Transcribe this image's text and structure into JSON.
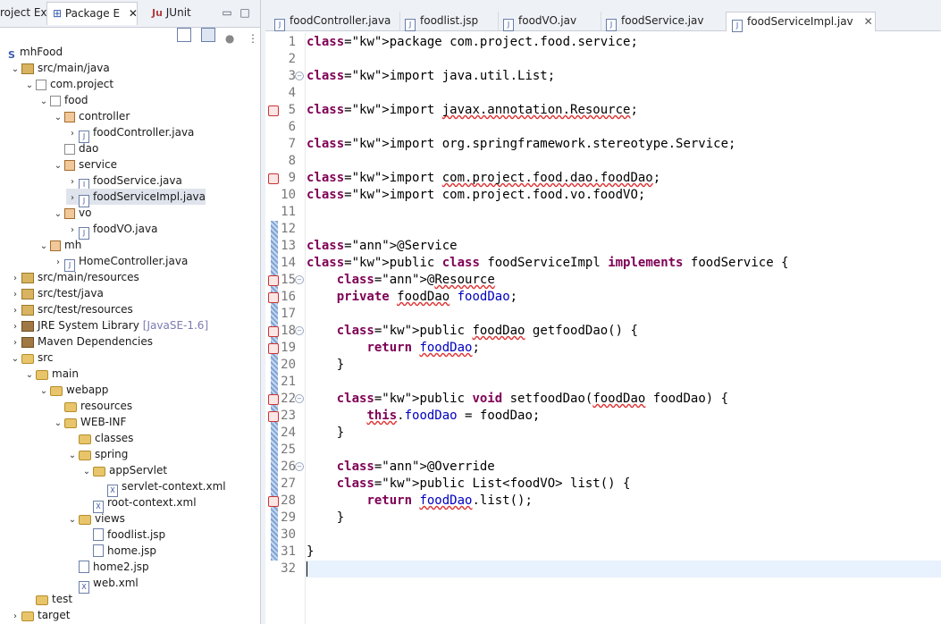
{
  "left_panel": {
    "tabs": [
      {
        "label": "roject Ex"
      },
      {
        "label": "Package E"
      },
      {
        "label": "JUnit"
      }
    ],
    "tree": [
      {
        "indent": 0,
        "twisty": "",
        "icon": "project",
        "label": "mhFood"
      },
      {
        "indent": 1,
        "twisty": "v",
        "icon": "srcfolder",
        "label": "src/main/java"
      },
      {
        "indent": 2,
        "twisty": "v",
        "icon": "package-empty",
        "label": "com.project"
      },
      {
        "indent": 3,
        "twisty": "v",
        "icon": "package-empty",
        "label": "food"
      },
      {
        "indent": 4,
        "twisty": "v",
        "icon": "package",
        "label": "controller"
      },
      {
        "indent": 5,
        "twisty": ">",
        "icon": "java",
        "label": "foodController.java"
      },
      {
        "indent": 4,
        "twisty": "",
        "icon": "package-empty",
        "label": "dao"
      },
      {
        "indent": 4,
        "twisty": "v",
        "icon": "package",
        "label": "service"
      },
      {
        "indent": 5,
        "twisty": ">",
        "icon": "java-interface",
        "label": "foodService.java"
      },
      {
        "indent": 5,
        "twisty": ">",
        "icon": "java",
        "label": "foodServiceImpl.java",
        "selected": true
      },
      {
        "indent": 4,
        "twisty": "v",
        "icon": "package",
        "label": "vo"
      },
      {
        "indent": 5,
        "twisty": ">",
        "icon": "java",
        "label": "foodVO.java"
      },
      {
        "indent": 3,
        "twisty": "v",
        "icon": "package",
        "label": "mh"
      },
      {
        "indent": 4,
        "twisty": ">",
        "icon": "java",
        "label": "HomeController.java"
      },
      {
        "indent": 1,
        "twisty": ">",
        "icon": "srcfolder",
        "label": "src/main/resources"
      },
      {
        "indent": 1,
        "twisty": ">",
        "icon": "srcfolder",
        "label": "src/test/java"
      },
      {
        "indent": 1,
        "twisty": ">",
        "icon": "srcfolder",
        "label": "src/test/resources"
      },
      {
        "indent": 1,
        "twisty": ">",
        "icon": "library",
        "label": "JRE System Library",
        "suffix": "[JavaSE-1.6]"
      },
      {
        "indent": 1,
        "twisty": ">",
        "icon": "library",
        "label": "Maven Dependencies"
      },
      {
        "indent": 1,
        "twisty": "v",
        "icon": "folder",
        "label": "src"
      },
      {
        "indent": 2,
        "twisty": "v",
        "icon": "folder",
        "label": "main"
      },
      {
        "indent": 3,
        "twisty": "v",
        "icon": "folder",
        "label": "webapp"
      },
      {
        "indent": 4,
        "twisty": "",
        "icon": "folder",
        "label": "resources"
      },
      {
        "indent": 4,
        "twisty": "v",
        "icon": "folder",
        "label": "WEB-INF"
      },
      {
        "indent": 5,
        "twisty": "",
        "icon": "folder",
        "label": "classes"
      },
      {
        "indent": 5,
        "twisty": "v",
        "icon": "folder",
        "label": "spring"
      },
      {
        "indent": 6,
        "twisty": "v",
        "icon": "folder",
        "label": "appServlet"
      },
      {
        "indent": 7,
        "twisty": "",
        "icon": "xml",
        "label": "servlet-context.xml"
      },
      {
        "indent": 6,
        "twisty": "",
        "icon": "xml",
        "label": "root-context.xml"
      },
      {
        "indent": 5,
        "twisty": "v",
        "icon": "folder",
        "label": "views"
      },
      {
        "indent": 6,
        "twisty": "",
        "icon": "jsp",
        "label": "foodlist.jsp"
      },
      {
        "indent": 6,
        "twisty": "",
        "icon": "jsp",
        "label": "home.jsp"
      },
      {
        "indent": 5,
        "twisty": "",
        "icon": "jsp",
        "label": "home2.jsp"
      },
      {
        "indent": 5,
        "twisty": "",
        "icon": "xml",
        "label": "web.xml"
      },
      {
        "indent": 2,
        "twisty": "",
        "icon": "folder",
        "label": "test"
      },
      {
        "indent": 1,
        "twisty": ">",
        "icon": "folder",
        "label": "target"
      }
    ]
  },
  "editor": {
    "tabs": [
      {
        "label": "foodController.java"
      },
      {
        "label": "foodlist.jsp"
      },
      {
        "label": "foodVO.jav"
      },
      {
        "label": "foodService.jav"
      },
      {
        "label": "foodServiceImpl.jav",
        "active": true
      }
    ],
    "lines": [
      {
        "n": "1",
        "code": "package com.project.food.service;"
      },
      {
        "n": "2",
        "code": ""
      },
      {
        "n": "3",
        "code": "import java.util.List;"
      },
      {
        "n": "4",
        "code": ""
      },
      {
        "n": "5",
        "code": "import javax.annotation.Resource;"
      },
      {
        "n": "6",
        "code": ""
      },
      {
        "n": "7",
        "code": "import org.springframework.stereotype.Service;"
      },
      {
        "n": "8",
        "code": ""
      },
      {
        "n": "9",
        "code": "import com.project.food.dao.foodDao;"
      },
      {
        "n": "10",
        "code": "import com.project.food.vo.foodVO;"
      },
      {
        "n": "11",
        "code": ""
      },
      {
        "n": "12",
        "code": ""
      },
      {
        "n": "13",
        "code": "@Service"
      },
      {
        "n": "14",
        "code": "public class foodServiceImpl implements foodService {"
      },
      {
        "n": "15",
        "code": "    @Resource"
      },
      {
        "n": "16",
        "code": "    private foodDao foodDao;"
      },
      {
        "n": "17",
        "code": ""
      },
      {
        "n": "18",
        "code": "    public foodDao getfoodDao() {"
      },
      {
        "n": "19",
        "code": "        return foodDao;"
      },
      {
        "n": "20",
        "code": "    }"
      },
      {
        "n": "21",
        "code": ""
      },
      {
        "n": "22",
        "code": "    public void setfoodDao(foodDao foodDao) {"
      },
      {
        "n": "23",
        "code": "        this.foodDao = foodDao;"
      },
      {
        "n": "24",
        "code": "    }"
      },
      {
        "n": "25",
        "code": ""
      },
      {
        "n": "26",
        "code": "    @Override"
      },
      {
        "n": "27",
        "code": "    public List<foodVO> list() {"
      },
      {
        "n": "28",
        "code": "        return foodDao.list();"
      },
      {
        "n": "29",
        "code": "    }"
      },
      {
        "n": "30",
        "code": ""
      },
      {
        "n": "31",
        "code": "}"
      },
      {
        "n": "32",
        "code": ""
      }
    ]
  },
  "colors": {
    "keyword": "#7f0055",
    "annotation": "#646464",
    "field": "#0000c0",
    "error_underline": "#d33333",
    "current_line": "#e8f2fe"
  }
}
